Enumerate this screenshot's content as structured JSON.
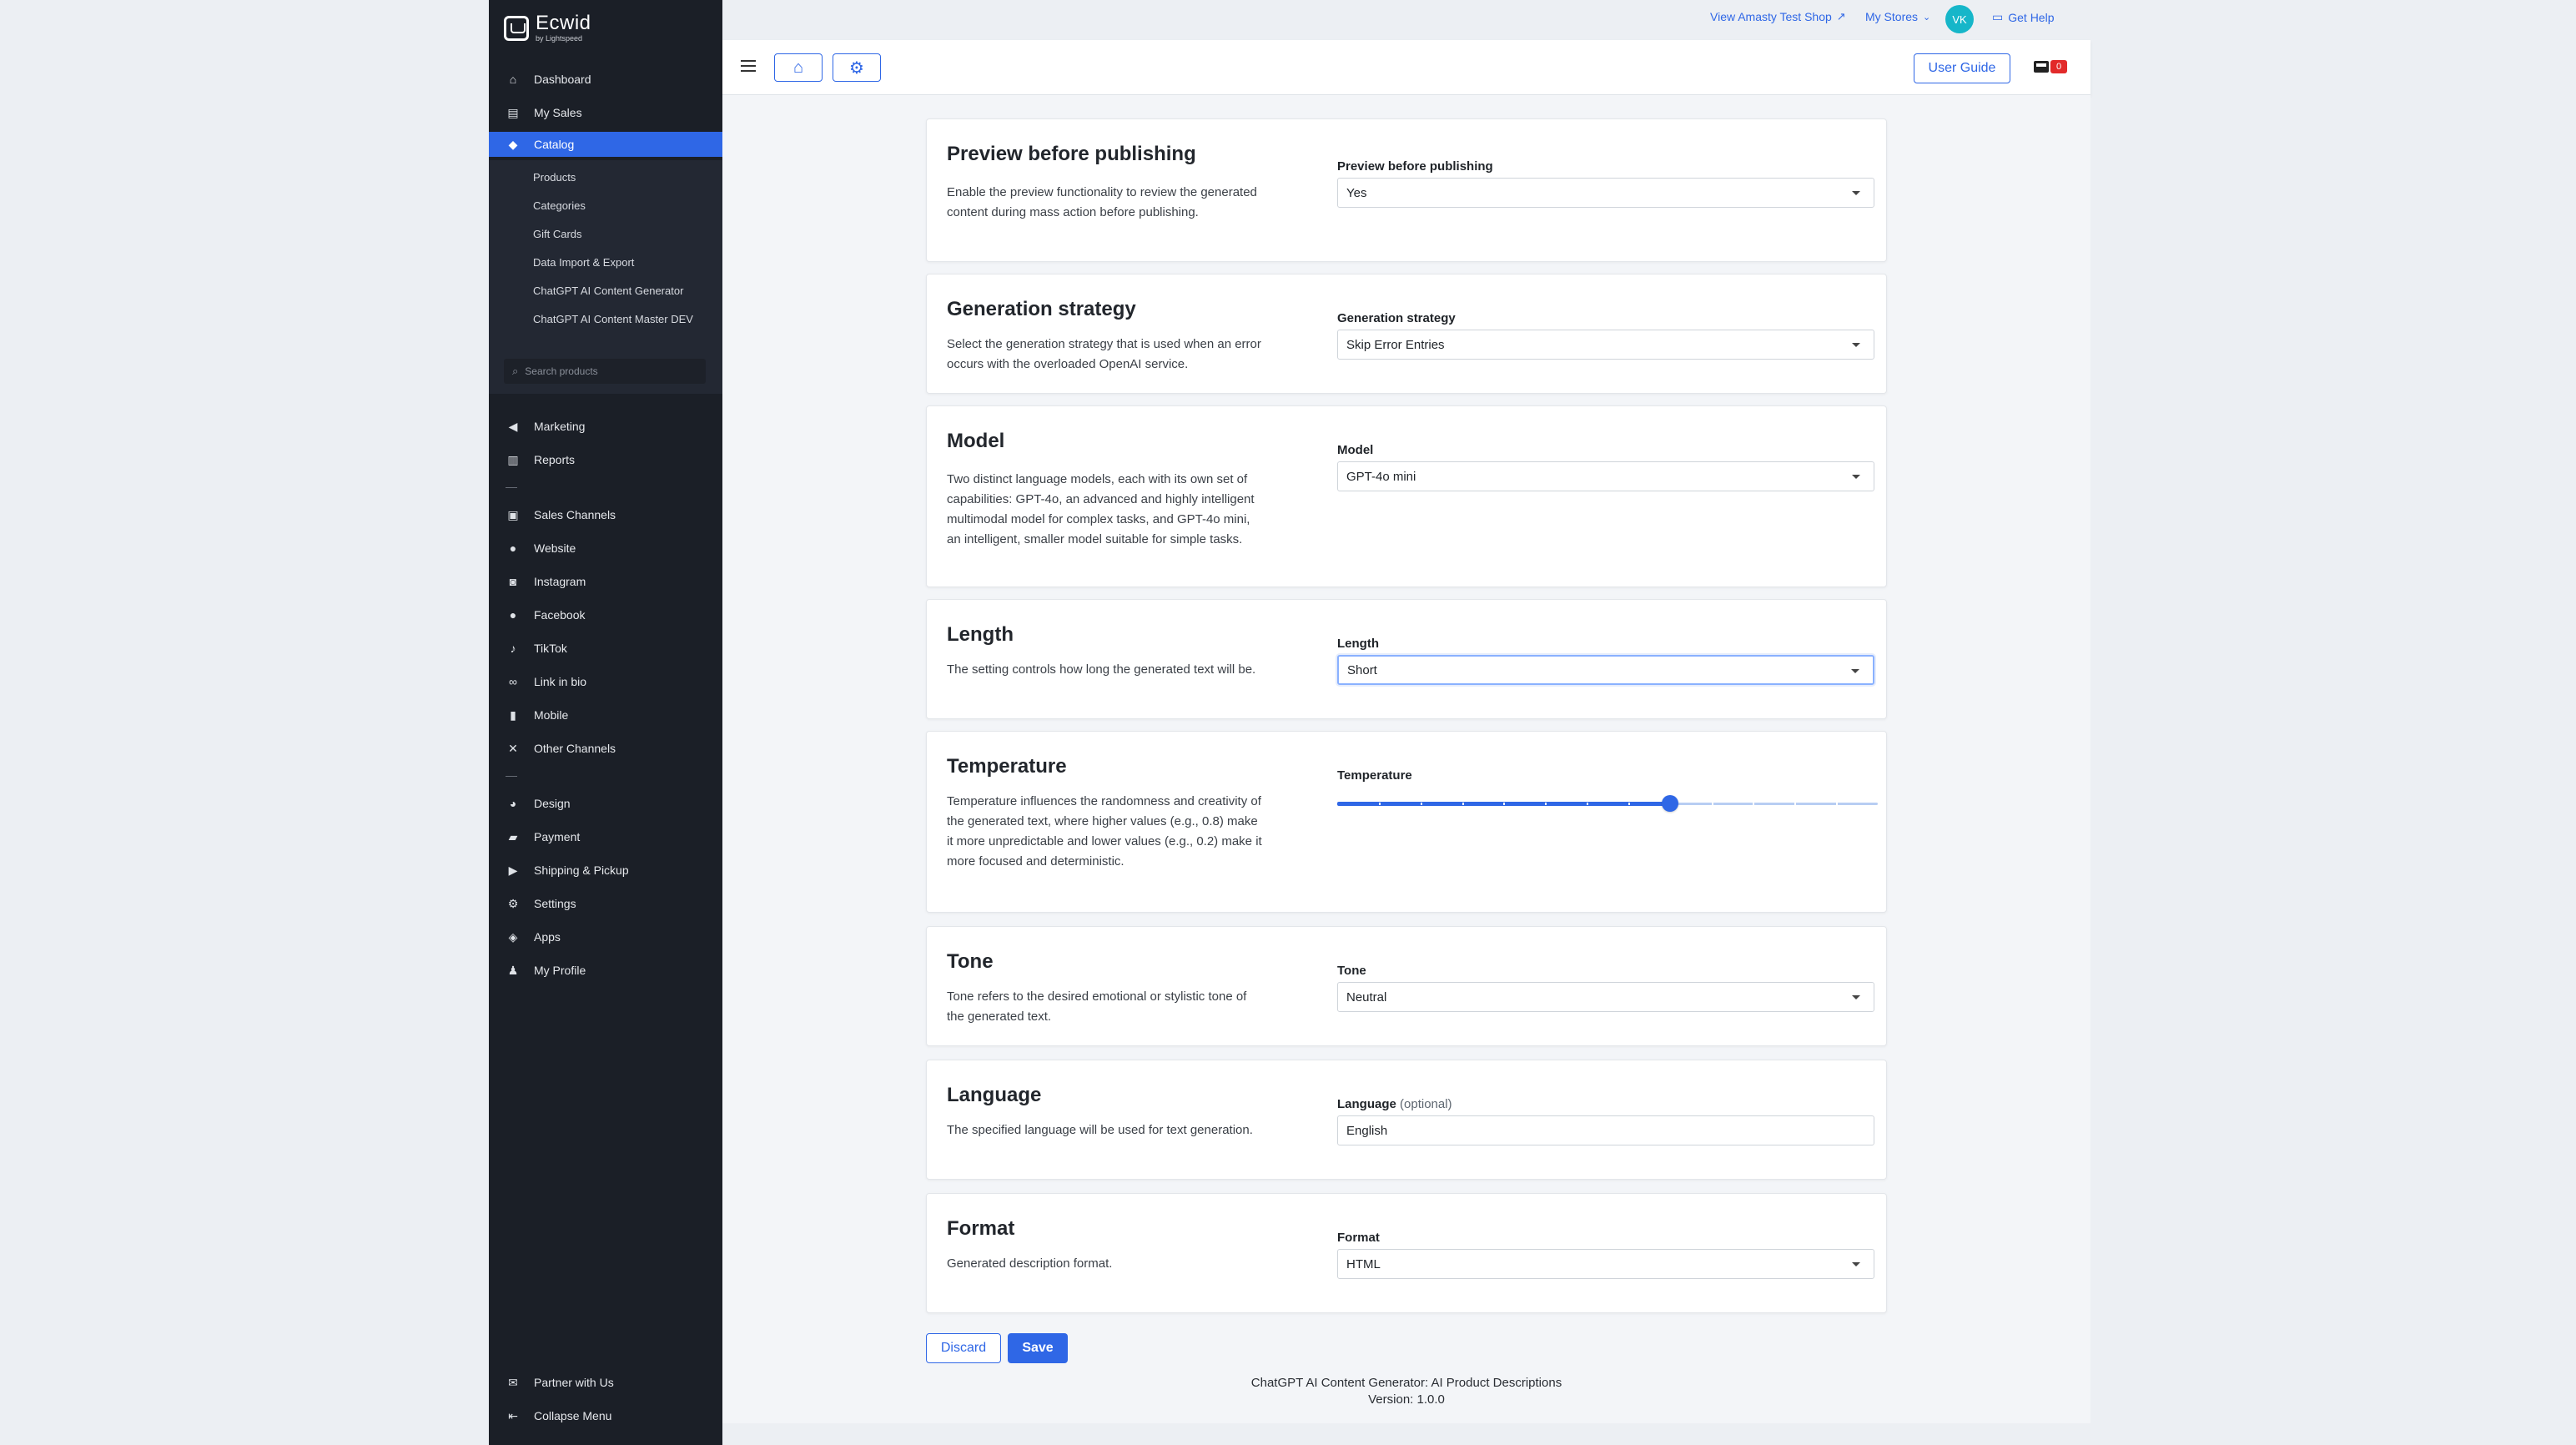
{
  "sidebar": {
    "logo": {
      "name": "Ecwid",
      "sub": "by Lightspeed"
    },
    "items": [
      {
        "label": "Dashboard",
        "icon": "home-icon"
      },
      {
        "label": "My Sales",
        "icon": "sales-icon"
      },
      {
        "label": "Catalog",
        "icon": "tag-icon"
      },
      {
        "label": "Marketing",
        "icon": "megaphone-icon"
      },
      {
        "label": "Reports",
        "icon": "chart-icon"
      },
      {
        "label": "Sales Channels",
        "icon": "channels-icon"
      },
      {
        "label": "Website",
        "icon": "globe-icon"
      },
      {
        "label": "Instagram",
        "icon": "instagram-icon"
      },
      {
        "label": "Facebook",
        "icon": "facebook-icon"
      },
      {
        "label": "TikTok",
        "icon": "tiktok-icon"
      },
      {
        "label": "Link in bio",
        "icon": "link-icon"
      },
      {
        "label": "Mobile",
        "icon": "mobile-icon"
      },
      {
        "label": "Other Channels",
        "icon": "network-icon"
      },
      {
        "label": "Design",
        "icon": "palette-icon"
      },
      {
        "label": "Payment",
        "icon": "wallet-icon"
      },
      {
        "label": "Shipping & Pickup",
        "icon": "truck-icon"
      },
      {
        "label": "Settings",
        "icon": "gear-icon"
      },
      {
        "label": "Apps",
        "icon": "layers-icon"
      },
      {
        "label": "My Profile",
        "icon": "user-icon"
      }
    ],
    "catalog_sub": [
      "Products",
      "Categories",
      "Gift Cards",
      "Data Import & Export",
      "ChatGPT AI Content Generator",
      "ChatGPT AI Content Master DEV"
    ],
    "search_placeholder": "Search products",
    "bottom": [
      {
        "label": "Partner with Us",
        "icon": "mail-icon"
      },
      {
        "label": "Collapse Menu",
        "icon": "collapse-icon"
      }
    ]
  },
  "topbar": {
    "view_shop": "View Amasty Test Shop",
    "my_stores": "My Stores",
    "avatar": "VK",
    "get_help": "Get Help"
  },
  "header": {
    "user_guide": "User Guide",
    "cart_count": "0"
  },
  "settings": [
    {
      "title": "Preview before publishing",
      "desc": "Enable the preview functionality to review the generated content during mass action before publishing.",
      "label": "Preview before publishing",
      "value": "Yes"
    },
    {
      "title": "Generation strategy",
      "desc": "Select the generation strategy that is used when an error occurs with the overloaded OpenAI service.",
      "label": "Generation strategy",
      "value": "Skip Error Entries"
    },
    {
      "title": "Model",
      "desc": "Two distinct language models, each with its own set of capabilities: GPT-4o, an advanced and highly intelligent multimodal model for complex tasks, and GPT-4o mini, an intelligent, smaller model suitable for simple tasks.",
      "label": "Model",
      "value": "GPT-4o mini"
    },
    {
      "title": "Length",
      "desc": "The setting controls how long the generated text will be.",
      "label": "Length",
      "value": "Short"
    },
    {
      "title": "Temperature",
      "desc": "Temperature influences the randomness and creativity of the generated text, where higher values (e.g., 0.8) make it more unpredictable and lower values (e.g., 0.2) make it more focused and deterministic.",
      "label": "Temperature",
      "slider_fraction": 0.615
    },
    {
      "title": "Tone",
      "desc": "Tone refers to the desired emotional or stylistic tone of the generated text.",
      "label": "Tone",
      "value": "Neutral"
    },
    {
      "title": "Language",
      "desc": "The specified language will be used for text generation.",
      "label": "Language",
      "label_optional": "(optional)",
      "value": "English"
    },
    {
      "title": "Format",
      "desc": "Generated description format.",
      "label": "Format",
      "value": "HTML"
    }
  ],
  "actions": {
    "discard": "Discard",
    "save": "Save"
  },
  "footer": {
    "line1": "ChatGPT AI Content Generator: AI Product Descriptions",
    "line2": "Version: 1.0.0"
  },
  "colors": {
    "accent": "#2f67e6",
    "sidebar_bg": "#1b1f27",
    "badge": "#e22a2a"
  }
}
